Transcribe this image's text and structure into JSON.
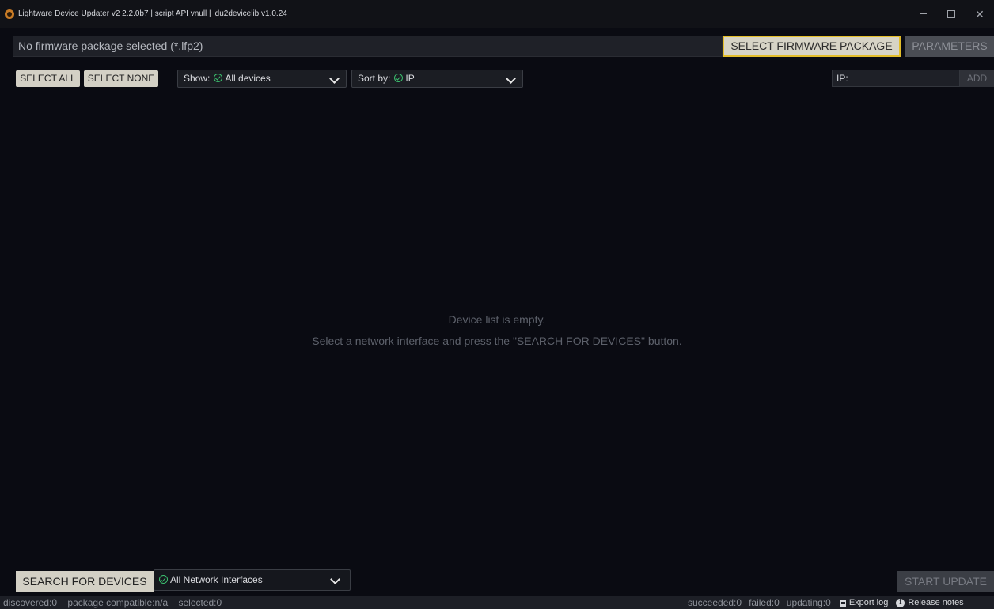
{
  "window": {
    "title": "Lightware Device Updater v2 2.2.0b7 | script API vnull | ldu2devicelib v1.0.24",
    "icon": "lightware-logo-icon",
    "controls": [
      "minimize-icon",
      "maximize-icon",
      "close-icon"
    ]
  },
  "firmware": {
    "status_text": "No firmware package selected (*.lfp2)",
    "select_button": "SELECT FIRMWARE PACKAGE",
    "parameters_button": "PARAMETERS"
  },
  "toolbar": {
    "select_all": "SELECT ALL",
    "select_none": "SELECT NONE",
    "show_prefix": "Show:",
    "show_value": "All devices",
    "sort_prefix": "Sort by:",
    "sort_value": "IP",
    "ip_value": "IP:",
    "add_button": "ADD"
  },
  "device_list": {
    "empty_line1": "Device list is empty.",
    "empty_line2": "Select a network interface and press the \"SEARCH FOR DEVICES\" button."
  },
  "bottom": {
    "search_button": "SEARCH FOR DEVICES",
    "network_value": "All Network Interfaces",
    "start_button": "START UPDATE"
  },
  "statusbar": {
    "discovered": "discovered:0",
    "package_compatible": "package compatible:n/a",
    "selected": "selected:0",
    "succeeded": "succeeded:0",
    "failed": "failed:0",
    "updating": "updating:0",
    "export_log": "Export log",
    "release_notes": "Release notes"
  },
  "colors": {
    "background": "#0a0b12",
    "accent_yellow": "#e4be2a",
    "check_green": "#3bbf6e"
  }
}
